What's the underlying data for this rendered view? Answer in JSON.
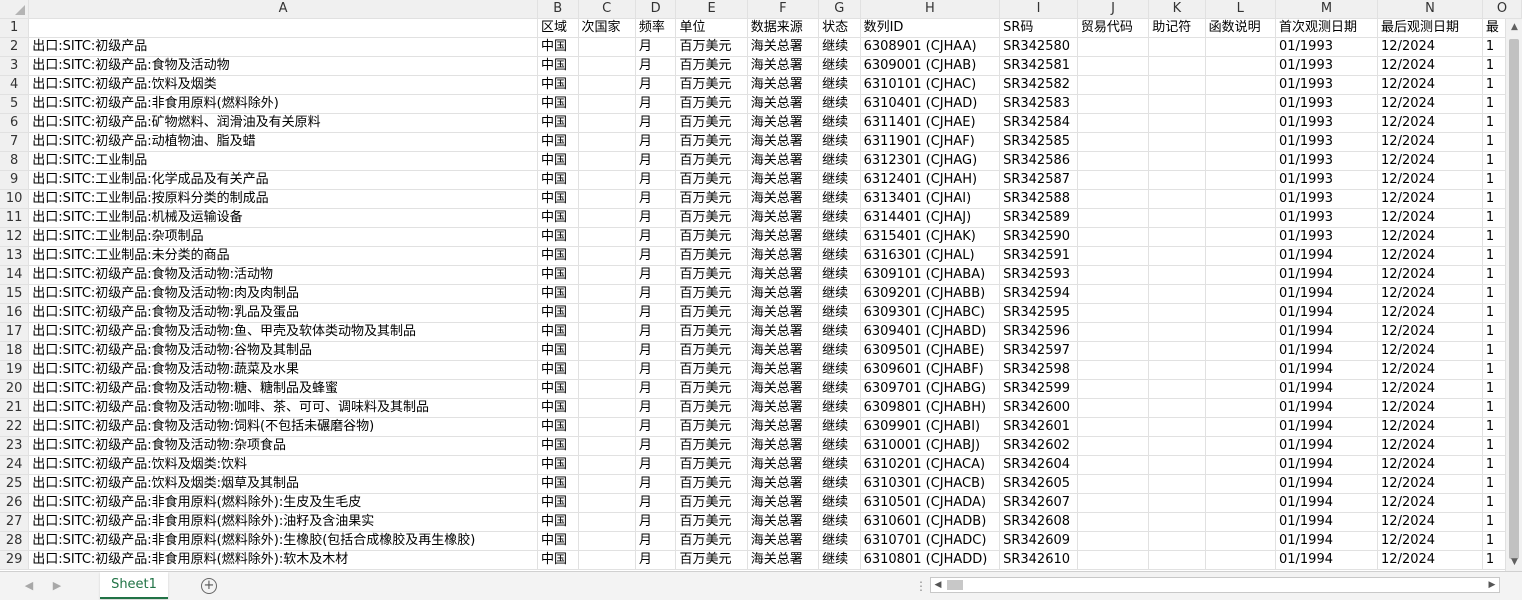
{
  "columns": [
    "A",
    "B",
    "C",
    "D",
    "E",
    "F",
    "G",
    "H",
    "I",
    "J",
    "K",
    "L",
    "M",
    "N",
    "O"
  ],
  "rows": [
    {
      "num": "1",
      "cells": [
        "",
        "区域",
        "次国家",
        "频率",
        "单位",
        "数据来源",
        "状态",
        "数列ID",
        "SR码",
        "贸易代码",
        "助记符",
        "函数说明",
        "首次观测日期",
        "最后观测日期",
        "最"
      ]
    },
    {
      "num": "2",
      "cells": [
        "出口:SITC:初级产品",
        "中国",
        "",
        "月",
        "百万美元",
        "海关总署",
        "继续",
        "6308901 (CJHAA)",
        "SR342580",
        "",
        "",
        "",
        "01/1993",
        "12/2024",
        "1"
      ]
    },
    {
      "num": "3",
      "cells": [
        "出口:SITC:初级产品:食物及活动物",
        "中国",
        "",
        "月",
        "百万美元",
        "海关总署",
        "继续",
        "6309001 (CJHAB)",
        "SR342581",
        "",
        "",
        "",
        "01/1993",
        "12/2024",
        "1"
      ]
    },
    {
      "num": "4",
      "cells": [
        "出口:SITC:初级产品:饮料及烟类",
        "中国",
        "",
        "月",
        "百万美元",
        "海关总署",
        "继续",
        "6310101 (CJHAC)",
        "SR342582",
        "",
        "",
        "",
        "01/1993",
        "12/2024",
        "1"
      ]
    },
    {
      "num": "5",
      "cells": [
        "出口:SITC:初级产品:非食用原料(燃料除外)",
        "中国",
        "",
        "月",
        "百万美元",
        "海关总署",
        "继续",
        "6310401 (CJHAD)",
        "SR342583",
        "",
        "",
        "",
        "01/1993",
        "12/2024",
        "1"
      ]
    },
    {
      "num": "6",
      "cells": [
        "出口:SITC:初级产品:矿物燃料、润滑油及有关原料",
        "中国",
        "",
        "月",
        "百万美元",
        "海关总署",
        "继续",
        "6311401 (CJHAE)",
        "SR342584",
        "",
        "",
        "",
        "01/1993",
        "12/2024",
        "1"
      ]
    },
    {
      "num": "7",
      "cells": [
        "出口:SITC:初级产品:动植物油、脂及蜡",
        "中国",
        "",
        "月",
        "百万美元",
        "海关总署",
        "继续",
        "6311901 (CJHAF)",
        "SR342585",
        "",
        "",
        "",
        "01/1993",
        "12/2024",
        "1"
      ]
    },
    {
      "num": "8",
      "cells": [
        "出口:SITC:工业制品",
        "中国",
        "",
        "月",
        "百万美元",
        "海关总署",
        "继续",
        "6312301 (CJHAG)",
        "SR342586",
        "",
        "",
        "",
        "01/1993",
        "12/2024",
        "1"
      ]
    },
    {
      "num": "9",
      "cells": [
        "出口:SITC:工业制品:化学成品及有关产品",
        "中国",
        "",
        "月",
        "百万美元",
        "海关总署",
        "继续",
        "6312401 (CJHAH)",
        "SR342587",
        "",
        "",
        "",
        "01/1993",
        "12/2024",
        "1"
      ]
    },
    {
      "num": "10",
      "cells": [
        "出口:SITC:工业制品:按原料分类的制成品",
        "中国",
        "",
        "月",
        "百万美元",
        "海关总署",
        "继续",
        "6313401 (CJHAI)",
        "SR342588",
        "",
        "",
        "",
        "01/1993",
        "12/2024",
        "1"
      ]
    },
    {
      "num": "11",
      "cells": [
        "出口:SITC:工业制品:机械及运输设备",
        "中国",
        "",
        "月",
        "百万美元",
        "海关总署",
        "继续",
        "6314401 (CJHAJ)",
        "SR342589",
        "",
        "",
        "",
        "01/1993",
        "12/2024",
        "1"
      ]
    },
    {
      "num": "12",
      "cells": [
        "出口:SITC:工业制品:杂项制品",
        "中国",
        "",
        "月",
        "百万美元",
        "海关总署",
        "继续",
        "6315401 (CJHAK)",
        "SR342590",
        "",
        "",
        "",
        "01/1993",
        "12/2024",
        "1"
      ]
    },
    {
      "num": "13",
      "cells": [
        "出口:SITC:工业制品:未分类的商品",
        "中国",
        "",
        "月",
        "百万美元",
        "海关总署",
        "继续",
        "6316301 (CJHAL)",
        "SR342591",
        "",
        "",
        "",
        "01/1994",
        "12/2024",
        "1"
      ]
    },
    {
      "num": "14",
      "cells": [
        "出口:SITC:初级产品:食物及活动物:活动物",
        "中国",
        "",
        "月",
        "百万美元",
        "海关总署",
        "继续",
        "6309101 (CJHABA)",
        "SR342593",
        "",
        "",
        "",
        "01/1994",
        "12/2024",
        "1"
      ]
    },
    {
      "num": "15",
      "cells": [
        "出口:SITC:初级产品:食物及活动物:肉及肉制品",
        "中国",
        "",
        "月",
        "百万美元",
        "海关总署",
        "继续",
        "6309201 (CJHABB)",
        "SR342594",
        "",
        "",
        "",
        "01/1994",
        "12/2024",
        "1"
      ]
    },
    {
      "num": "16",
      "cells": [
        "出口:SITC:初级产品:食物及活动物:乳品及蛋品",
        "中国",
        "",
        "月",
        "百万美元",
        "海关总署",
        "继续",
        "6309301 (CJHABC)",
        "SR342595",
        "",
        "",
        "",
        "01/1994",
        "12/2024",
        "1"
      ]
    },
    {
      "num": "17",
      "cells": [
        "出口:SITC:初级产品:食物及活动物:鱼、甲壳及软体类动物及其制品",
        "中国",
        "",
        "月",
        "百万美元",
        "海关总署",
        "继续",
        "6309401 (CJHABD)",
        "SR342596",
        "",
        "",
        "",
        "01/1994",
        "12/2024",
        "1"
      ]
    },
    {
      "num": "18",
      "cells": [
        "出口:SITC:初级产品:食物及活动物:谷物及其制品",
        "中国",
        "",
        "月",
        "百万美元",
        "海关总署",
        "继续",
        "6309501 (CJHABE)",
        "SR342597",
        "",
        "",
        "",
        "01/1994",
        "12/2024",
        "1"
      ]
    },
    {
      "num": "19",
      "cells": [
        "出口:SITC:初级产品:食物及活动物:蔬菜及水果",
        "中国",
        "",
        "月",
        "百万美元",
        "海关总署",
        "继续",
        "6309601 (CJHABF)",
        "SR342598",
        "",
        "",
        "",
        "01/1994",
        "12/2024",
        "1"
      ]
    },
    {
      "num": "20",
      "cells": [
        "出口:SITC:初级产品:食物及活动物:糖、糖制品及蜂蜜",
        "中国",
        "",
        "月",
        "百万美元",
        "海关总署",
        "继续",
        "6309701 (CJHABG)",
        "SR342599",
        "",
        "",
        "",
        "01/1994",
        "12/2024",
        "1"
      ]
    },
    {
      "num": "21",
      "cells": [
        "出口:SITC:初级产品:食物及活动物:咖啡、茶、可可、调味料及其制品",
        "中国",
        "",
        "月",
        "百万美元",
        "海关总署",
        "继续",
        "6309801 (CJHABH)",
        "SR342600",
        "",
        "",
        "",
        "01/1994",
        "12/2024",
        "1"
      ]
    },
    {
      "num": "22",
      "cells": [
        "出口:SITC:初级产品:食物及活动物:饲料(不包括未碾磨谷物)",
        "中国",
        "",
        "月",
        "百万美元",
        "海关总署",
        "继续",
        "6309901 (CJHABI)",
        "SR342601",
        "",
        "",
        "",
        "01/1994",
        "12/2024",
        "1"
      ]
    },
    {
      "num": "23",
      "cells": [
        "出口:SITC:初级产品:食物及活动物:杂项食品",
        "中国",
        "",
        "月",
        "百万美元",
        "海关总署",
        "继续",
        "6310001 (CJHABJ)",
        "SR342602",
        "",
        "",
        "",
        "01/1994",
        "12/2024",
        "1"
      ]
    },
    {
      "num": "24",
      "cells": [
        "出口:SITC:初级产品:饮料及烟类:饮料",
        "中国",
        "",
        "月",
        "百万美元",
        "海关总署",
        "继续",
        "6310201 (CJHACA)",
        "SR342604",
        "",
        "",
        "",
        "01/1994",
        "12/2024",
        "1"
      ]
    },
    {
      "num": "25",
      "cells": [
        "出口:SITC:初级产品:饮料及烟类:烟草及其制品",
        "中国",
        "",
        "月",
        "百万美元",
        "海关总署",
        "继续",
        "6310301 (CJHACB)",
        "SR342605",
        "",
        "",
        "",
        "01/1994",
        "12/2024",
        "1"
      ]
    },
    {
      "num": "26",
      "cells": [
        "出口:SITC:初级产品:非食用原料(燃料除外):生皮及生毛皮",
        "中国",
        "",
        "月",
        "百万美元",
        "海关总署",
        "继续",
        "6310501 (CJHADA)",
        "SR342607",
        "",
        "",
        "",
        "01/1994",
        "12/2024",
        "1"
      ]
    },
    {
      "num": "27",
      "cells": [
        "出口:SITC:初级产品:非食用原料(燃料除外):油籽及含油果实",
        "中国",
        "",
        "月",
        "百万美元",
        "海关总署",
        "继续",
        "6310601 (CJHADB)",
        "SR342608",
        "",
        "",
        "",
        "01/1994",
        "12/2024",
        "1"
      ]
    },
    {
      "num": "28",
      "cells": [
        "出口:SITC:初级产品:非食用原料(燃料除外):生橡胶(包括合成橡胶及再生橡胶)",
        "中国",
        "",
        "月",
        "百万美元",
        "海关总署",
        "继续",
        "6310701 (CJHADC)",
        "SR342609",
        "",
        "",
        "",
        "01/1994",
        "12/2024",
        "1"
      ]
    },
    {
      "num": "29",
      "cells": [
        "出口:SITC:初级产品:非食用原料(燃料除外):软木及木材",
        "中国",
        "",
        "月",
        "百万美元",
        "海关总署",
        "继续",
        "6310801 (CJHADD)",
        "SR342610",
        "",
        "",
        "",
        "01/1994",
        "12/2024",
        "1"
      ]
    }
  ],
  "sheet_tab": "Sheet1",
  "add_sheet_symbol": "+",
  "tab_nav_prev": "◀",
  "tab_nav_next": "▶",
  "hscroll_left": "◀",
  "hscroll_right": "▶",
  "vscroll_up": "▲",
  "vscroll_down": "▼",
  "dots": "⋮",
  "accent_color": "#217346"
}
